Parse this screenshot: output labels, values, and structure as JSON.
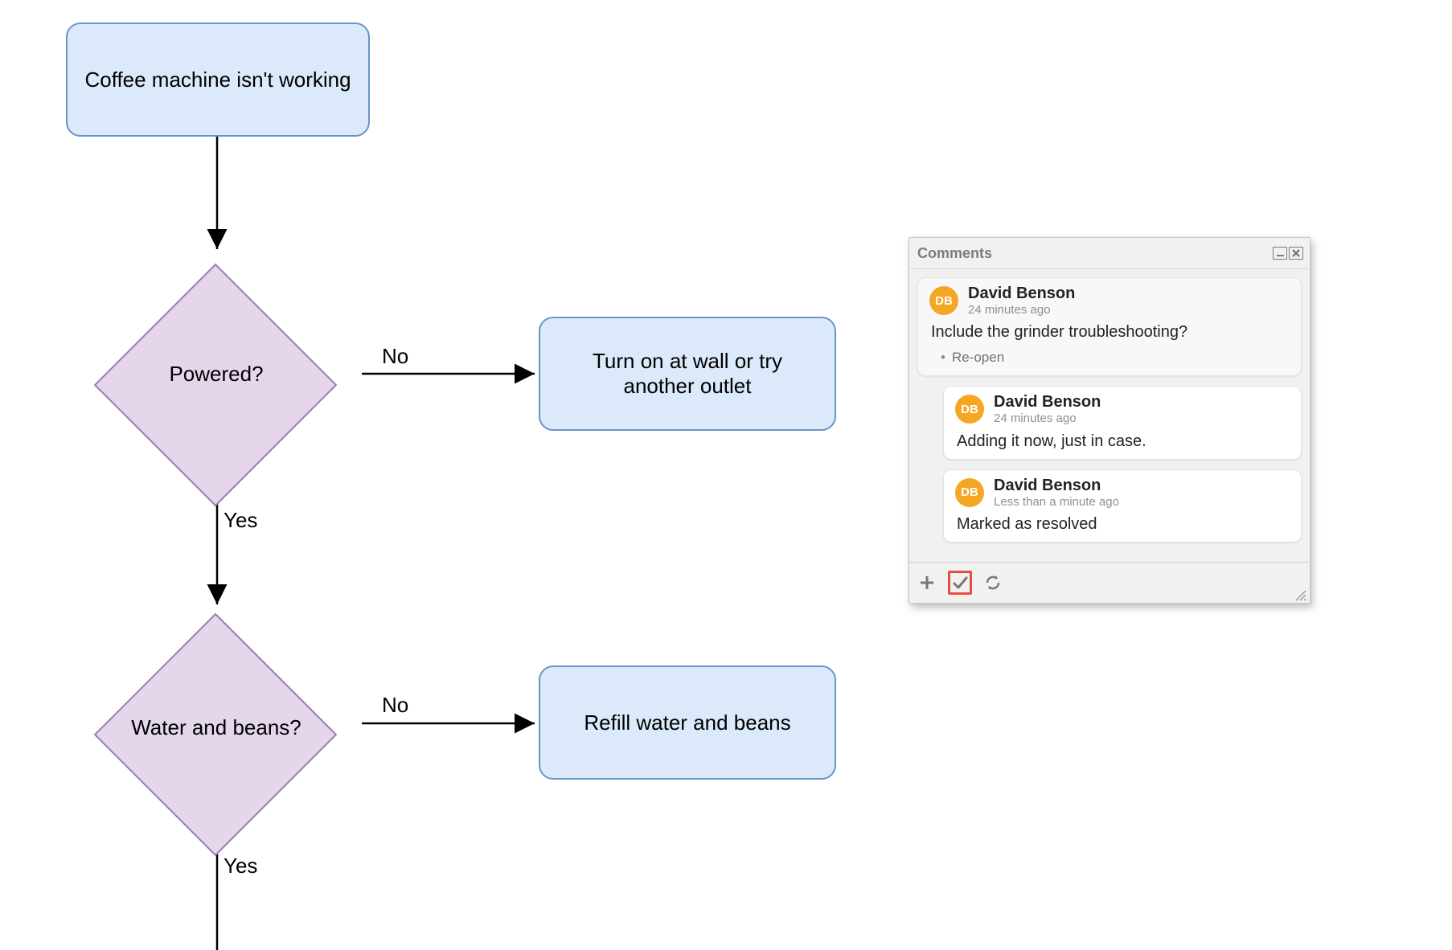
{
  "flowchart": {
    "nodes": {
      "start": "Coffee machine isn't working",
      "powered": "Powered?",
      "outlet": "Turn on at wall or try another outlet",
      "water_beans": "Water and beans?",
      "refill": "Refill water and beans"
    },
    "edges": {
      "powered_no": "No",
      "powered_yes": "Yes",
      "water_no": "No",
      "water_yes": "Yes"
    }
  },
  "panel": {
    "title": "Comments",
    "comments": [
      {
        "avatar": "DB",
        "author": "David Benson",
        "time": "24 minutes ago",
        "body": "Include the grinder troubleshooting?",
        "action": "Re-open",
        "is_main": true
      },
      {
        "avatar": "DB",
        "author": "David Benson",
        "time": "24 minutes ago",
        "body": "Adding it now, just in case.",
        "is_reply": true
      },
      {
        "avatar": "DB",
        "author": "David Benson",
        "time": "Less than a minute ago",
        "body": "Marked as resolved",
        "is_reply": true
      }
    ],
    "footer_icons": {
      "add": "plus-icon",
      "resolve": "checkmark-icon",
      "refresh": "refresh-icon"
    }
  }
}
